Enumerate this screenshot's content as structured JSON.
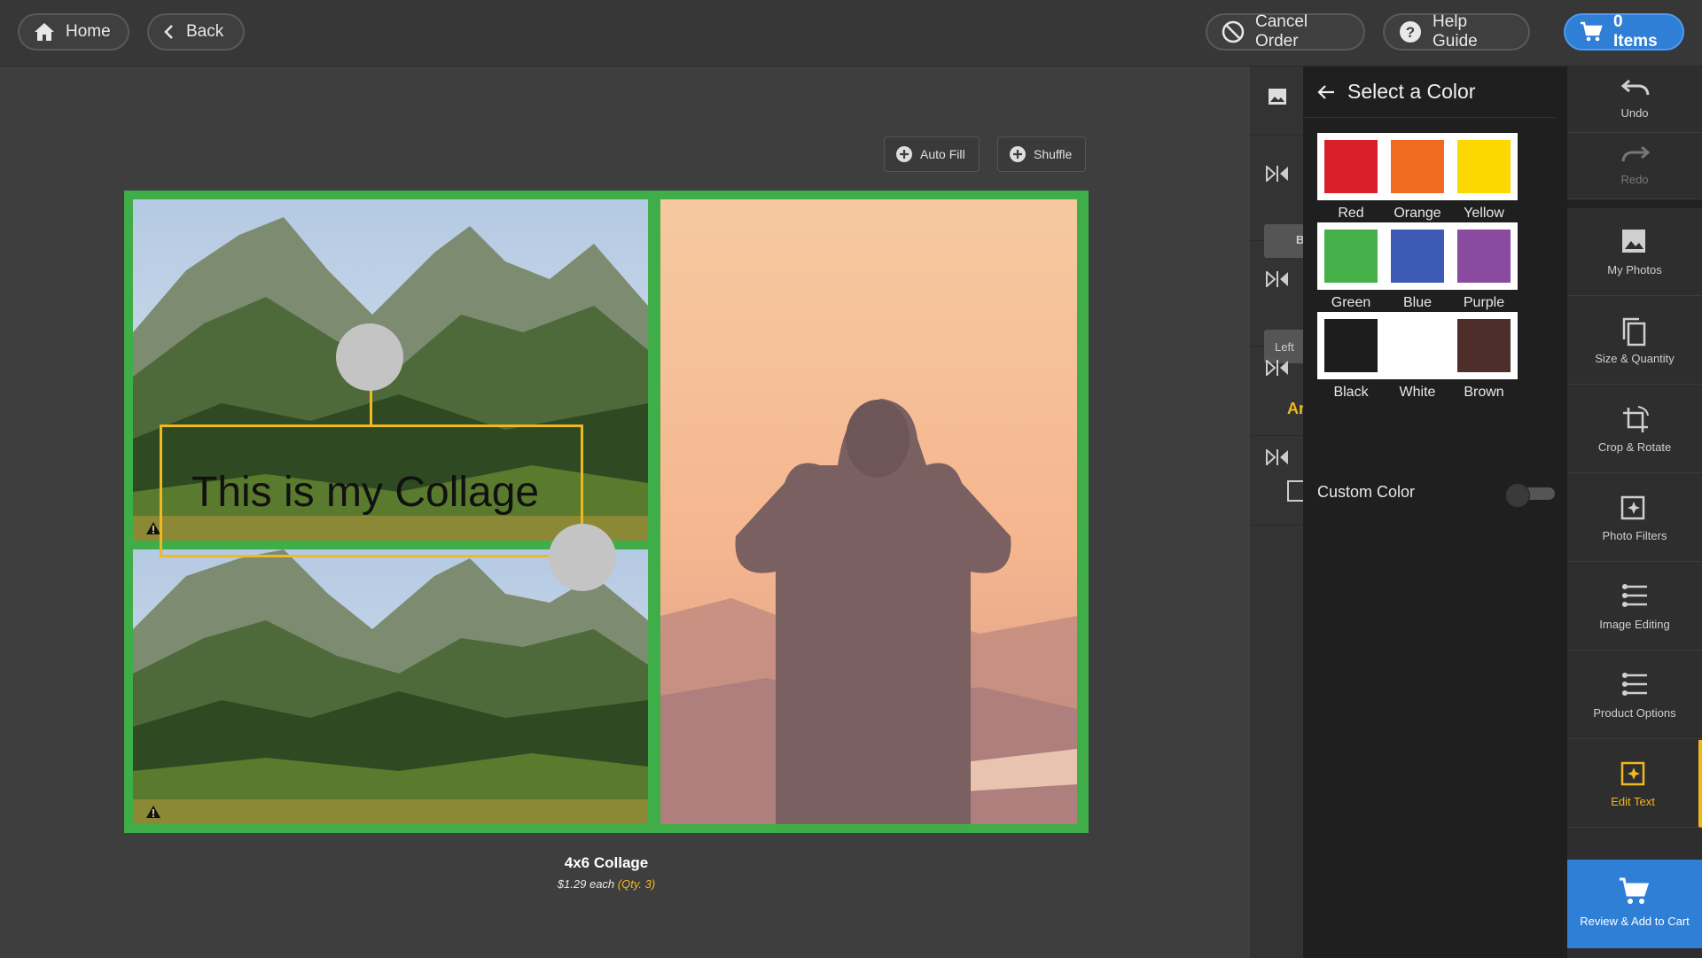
{
  "topbar": {
    "home_label": "Home",
    "back_label": "Back",
    "cancel_label": "Cancel Order",
    "help_label": "Help Guide",
    "cart_label": "0 Items"
  },
  "toolbar": {
    "autofill_label": "Auto Fill",
    "shuffle_label": "Shuffle"
  },
  "collage": {
    "text": "This is my Collage",
    "frame_color": "#3fae49",
    "selection_color": "#f2b81f"
  },
  "caption": {
    "title": "4x6 Collage",
    "price": "$1.29 each",
    "qty": "(Qty. 3)"
  },
  "under_panel": {
    "chip_b": "B",
    "chip_left": "Left",
    "text_a": "Ar"
  },
  "color_panel": {
    "title": "Select a Color",
    "colors": [
      {
        "label": "Red",
        "hex": "#d9202a"
      },
      {
        "label": "Orange",
        "hex": "#f06b20"
      },
      {
        "label": "Yellow",
        "hex": "#fdd700"
      },
      {
        "label": "Green",
        "hex": "#45b04a"
      },
      {
        "label": "Blue",
        "hex": "#3d5bb5"
      },
      {
        "label": "Purple",
        "hex": "#8a4a9f"
      },
      {
        "label": "Black",
        "hex": "#1d1d1d"
      },
      {
        "label": "White",
        "hex": "#ffffff"
      },
      {
        "label": "Brown",
        "hex": "#4d2e2a"
      }
    ],
    "custom_label": "Custom Color"
  },
  "sidebar": {
    "undo": "Undo",
    "redo": "Redo",
    "my_photos": "My Photos",
    "size_quantity": "Size & Quantity",
    "crop_rotate": "Crop & Rotate",
    "photo_filters": "Photo Filters",
    "image_editing": "Image Editing",
    "product_options": "Product Options",
    "edit_text": "Edit Text",
    "review_cart": "Review & Add to Cart"
  }
}
